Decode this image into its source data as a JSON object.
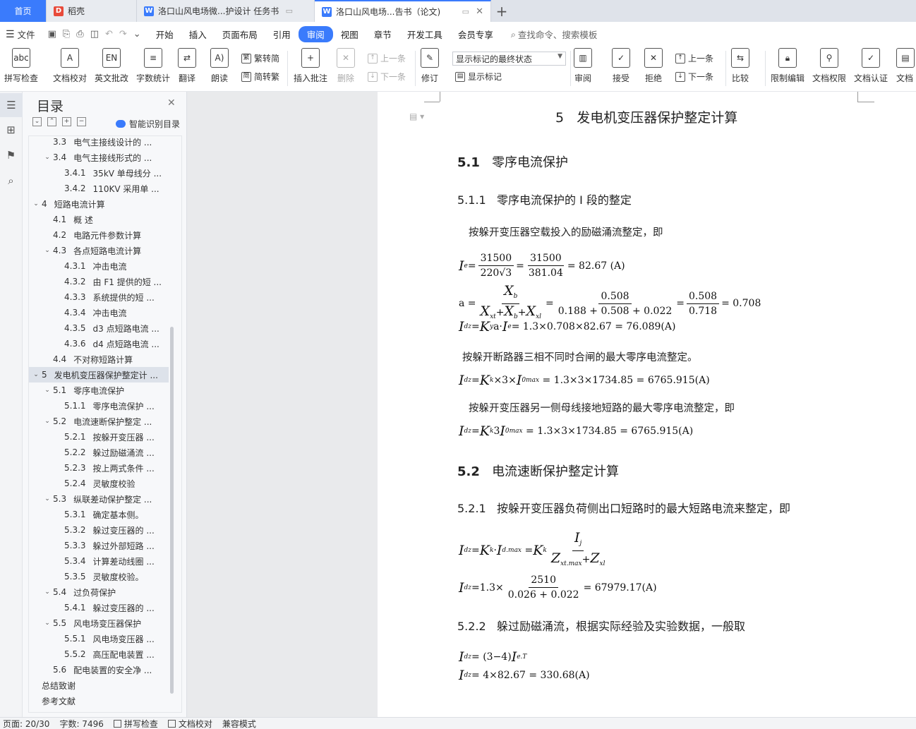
{
  "tabs": [
    {
      "label": "首页"
    },
    {
      "label": "稻壳"
    },
    {
      "label": "洛口山风电场微...护设计 任务书"
    },
    {
      "label": "洛口山风电场...告书（论文)"
    }
  ],
  "menu": {
    "file": "文件",
    "items": [
      "开始",
      "插入",
      "页面布局",
      "引用",
      "审阅",
      "视图",
      "章节",
      "开发工具",
      "会员专享"
    ],
    "search": "查找命令、搜索模板"
  },
  "ribbon": {
    "spell": "拼写检查",
    "doc_check": "文档校对",
    "en_review": "英文批改",
    "word_count": "字数统计",
    "translate": "翻译",
    "read_aloud": "朗读",
    "trad_to_simp": "繁转简",
    "simp_to_trad": "简转繁",
    "insert_comment": "插入批注",
    "delete": "删除",
    "prev1": "上一条",
    "next1": "下一条",
    "revise": "修订",
    "show_markup_combo": "显示标记的最终状态",
    "show_markup": "显示标记",
    "review": "审阅",
    "accept": "接受",
    "reject": "拒绝",
    "prev2": "上一条",
    "next2": "下一条",
    "compare": "比较",
    "restrict_edit": "限制编辑",
    "doc_rights": "文档权限",
    "doc_auth": "文档认证",
    "doc_cut": "文档"
  },
  "toc": {
    "title": "目录",
    "ai_label": "智能识别目录",
    "items": [
      {
        "num": "3.3",
        "text": "电气主接线设计的 ..."
      },
      {
        "num": "3.4",
        "text": "电气主接线形式的 ..."
      },
      {
        "num": "3.4.1",
        "text": "35kV 单母线分 ..."
      },
      {
        "num": "3.4.2",
        "text": "110KV 采用单 ..."
      },
      {
        "num": "4",
        "text": "短路电流计算"
      },
      {
        "num": "4.1",
        "text": "概  述"
      },
      {
        "num": "4.2",
        "text": "电路元件参数计算"
      },
      {
        "num": "4.3",
        "text": "各点短路电流计算"
      },
      {
        "num": "4.3.1",
        "text": "冲击电流"
      },
      {
        "num": "4.3.2",
        "text": "由 F1 提供的短 ..."
      },
      {
        "num": "4.3.3",
        "text": "系统提供的短 ..."
      },
      {
        "num": "4.3.4",
        "text": "冲击电流"
      },
      {
        "num": "4.3.5",
        "text": "d3 点短路电流 ..."
      },
      {
        "num": "4.3.6",
        "text": "d4 点短路电流 ..."
      },
      {
        "num": "4.4",
        "text": "不对称短路计算"
      },
      {
        "num": "5",
        "text": "发电机变压器保护整定计 ..."
      },
      {
        "num": "5.1",
        "text": "零序电流保护"
      },
      {
        "num": "5.1.1",
        "text": "零序电流保护 ..."
      },
      {
        "num": "5.2",
        "text": "电流速断保护整定 ..."
      },
      {
        "num": "5.2.1",
        "text": "按躲开变压器 ..."
      },
      {
        "num": "5.2.2",
        "text": "躲过励磁涌流 ..."
      },
      {
        "num": "5.2.3",
        "text": "按上两式条件 ..."
      },
      {
        "num": "5.2.4",
        "text": "灵敏度校验"
      },
      {
        "num": "5.3",
        "text": "纵联差动保护整定 ..."
      },
      {
        "num": "5.3.1",
        "text": "确定基本侧。"
      },
      {
        "num": "5.3.2",
        "text": "躲过变压器的 ..."
      },
      {
        "num": "5.3.3",
        "text": "躲过外部短路 ..."
      },
      {
        "num": "5.3.4",
        "text": "计算差动线圈 ..."
      },
      {
        "num": "5.3.5",
        "text": "灵敏度校验。"
      },
      {
        "num": "5.4",
        "text": "过负荷保护"
      },
      {
        "num": "5.4.1",
        "text": "躲过变压器的 ..."
      },
      {
        "num": "5.5",
        "text": "风电场变压器保护"
      },
      {
        "num": "5.5.1",
        "text": "风电场变压器 ..."
      },
      {
        "num": "5.5.2",
        "text": "高压配电装置 ..."
      },
      {
        "num": "5.6",
        "text": "配电装置的安全净 ..."
      },
      {
        "num": "",
        "text": "总结致谢"
      },
      {
        "num": "",
        "text": "参考文献"
      }
    ]
  },
  "doc": {
    "h1_num": "5",
    "h1_text": "发电机变压器保护整定计算",
    "s51_num": "5.1",
    "s51_text": "零序电流保护",
    "s511_num": "5.1.1",
    "s511_text": "零序电流保护的 I 段的整定",
    "p1": "按躲开变压器空载投入的励磁涌流整定，即",
    "eq1": {
      "n1": "31500",
      "d1": "220√3",
      "n2": "31500",
      "d2": "381.04",
      "res": "= 82.67 (A)"
    },
    "eq2": {
      "num": "X",
      "num_sub": "b",
      "den": "X",
      "den_rest": "+ X",
      "den_rest2": "+ X",
      "n2": "0.508",
      "d2": "0.188 + 0.508 + 0.022",
      "n3": "0.508",
      "d3": "0.718",
      "res": "= 0.708"
    },
    "eq3": "= 1.3×0.708×82.67 = 76.089(A)",
    "p2": "按躲开断路器三相不同时合闸的最大零序电流整定。",
    "eq4": "= 1.3×3×1734.85 = 6765.915(A)",
    "p3": "按躲开变压器另一侧母线接地短路的最大零序电流整定，即",
    "eq5": "= 1.3×3×1734.85 = 6765.915(A)",
    "s52_num": "5.2",
    "s52_text": "电流速断保护整定计算",
    "s521_num": "5.2.1",
    "s521_text": "按躲开变压器负荷侧出口短路时的最大短路电流来整定，即",
    "eq6_res": "",
    "eq7": {
      "num": "2510",
      "den": "0.026 + 0.022",
      "res": "= 67979.17(A)"
    },
    "s522_num": "5.2.2",
    "s522_text": "躲过励磁涌流，根据实际经验及实验数据，一般取",
    "eq8": "= (3−4)",
    "eq9": "= 4×82.67 = 330.68(A)"
  },
  "status": {
    "page": "页面: 20/30",
    "words": "字数: 7496",
    "spell": "拼写检查",
    "doc_check": "文档校对",
    "compat": "兼容模式"
  },
  "colors": {
    "accent": "#3a7bfc"
  }
}
